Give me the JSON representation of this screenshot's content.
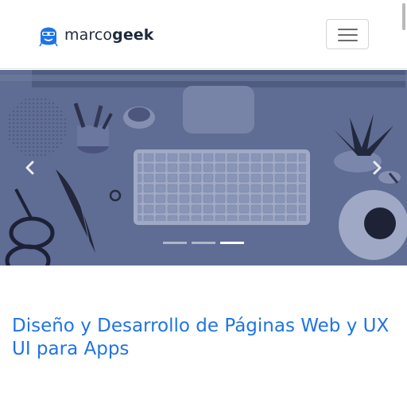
{
  "navbar": {
    "brand_prefix": "marco",
    "brand_suffix": "geek",
    "toggle_icon": "hamburger-menu-icon",
    "logo_icon": "geek-mascot-logo-icon",
    "brand_color": "#1f74e6"
  },
  "carousel": {
    "prev_label": "Previous",
    "next_label": "Next",
    "slide_count": 3,
    "active_index": 2,
    "image_subject": "desk with keyboard, glasses, feather pen, plant and coffee cup",
    "overlay_color": "#5f6d94"
  },
  "hero": {
    "title": "Diseño y Desarrollo de Páginas Web y UX UI para Apps",
    "title_color": "#1f74e6"
  }
}
